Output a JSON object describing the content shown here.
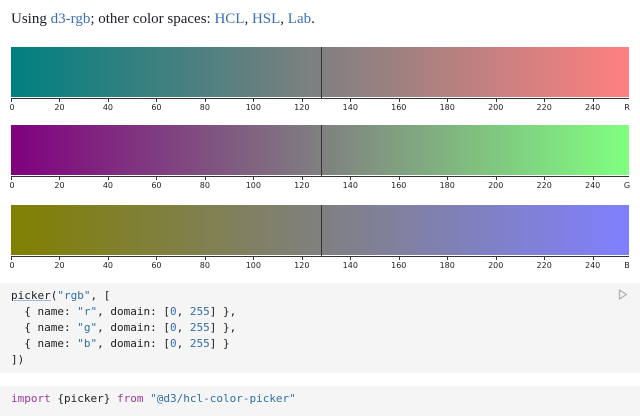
{
  "intro": {
    "prefix": "Using ",
    "current_space": "d3-rgb",
    "middle": "; other color spaces: ",
    "hcl": "HCL",
    "sep1": ", ",
    "hsl": "HSL",
    "sep2": ", ",
    "lab": "Lab",
    "suffix": "."
  },
  "picker": {
    "space": "rgb",
    "current": {
      "r": 128,
      "g": 128,
      "b": 128
    },
    "domain": [
      0,
      255
    ],
    "ticks": [
      "0",
      "20",
      "40",
      "60",
      "80",
      "100",
      "120",
      "140",
      "160",
      "180",
      "200",
      "220",
      "240"
    ],
    "tick_values": [
      0,
      20,
      40,
      60,
      80,
      100,
      120,
      140,
      160,
      180,
      200,
      220,
      240
    ],
    "channels": [
      {
        "name": "R",
        "start_color": "#008080",
        "end_color": "#ff8080"
      },
      {
        "name": "G",
        "start_color": "#800080",
        "end_color": "#80ff80"
      },
      {
        "name": "B",
        "start_color": "#808000",
        "end_color": "#8080ff"
      }
    ]
  },
  "code_cell": {
    "line1_fn": "picker",
    "line1_rest_open": "(",
    "line1_arg": "\"rgb\"",
    "line1_tail": ", [",
    "line2": {
      "pre": "  { name: ",
      "name": "\"r\"",
      "mid": ", domain: [",
      "a": "0",
      "comma": ", ",
      "b": "255",
      "end": "] },"
    },
    "line3": {
      "pre": "  { name: ",
      "name": "\"g\"",
      "mid": ", domain: [",
      "a": "0",
      "comma": ", ",
      "b": "255",
      "end": "] },"
    },
    "line4": {
      "pre": "  { name: ",
      "name": "\"b\"",
      "mid": ", domain: [",
      "a": "0",
      "comma": ", ",
      "b": "255",
      "end": "] }"
    },
    "line5": "])"
  },
  "code_cell_2": {
    "kw1": "import",
    "mid": " {picker} ",
    "kw2": "from",
    "src": " \"@d3/hcl-color-picker\""
  }
}
